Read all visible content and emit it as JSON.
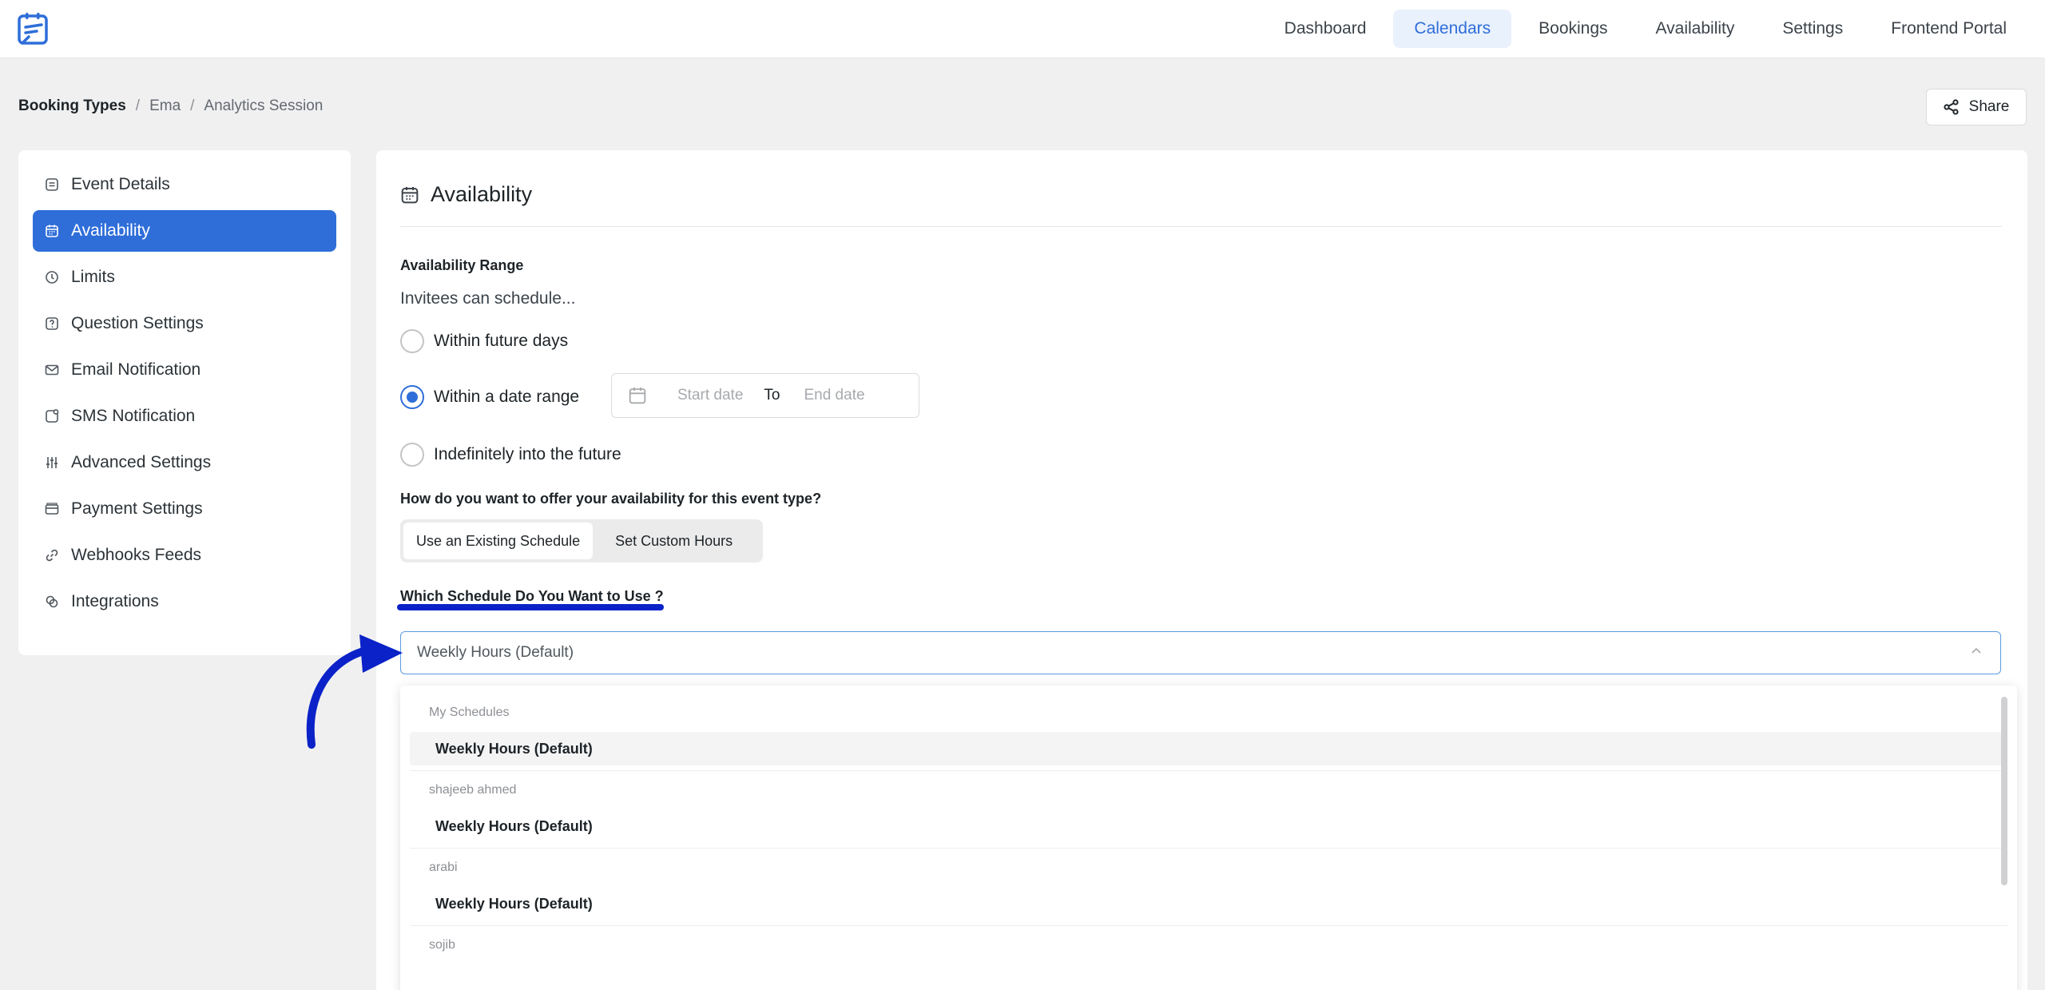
{
  "colors": {
    "accent": "#2f6ed9",
    "annotation": "#0b22c8"
  },
  "nav": {
    "items": [
      "Dashboard",
      "Calendars",
      "Bookings",
      "Availability",
      "Settings",
      "Frontend Portal"
    ],
    "active": "Calendars"
  },
  "breadcrumb": {
    "root": "Booking Types",
    "sep": "/",
    "level1": "Ema",
    "level2": "Analytics Session"
  },
  "share": {
    "label": "Share",
    "icon": "share-icon"
  },
  "sidebar": {
    "items": [
      {
        "label": "Event Details",
        "icon": "event-details-icon"
      },
      {
        "label": "Availability",
        "icon": "calendar-icon",
        "active": true
      },
      {
        "label": "Limits",
        "icon": "clock-icon"
      },
      {
        "label": "Question Settings",
        "icon": "question-icon"
      },
      {
        "label": "Email Notification",
        "icon": "mail-icon"
      },
      {
        "label": "SMS Notification",
        "icon": "sms-icon"
      },
      {
        "label": "Advanced Settings",
        "icon": "sliders-icon"
      },
      {
        "label": "Payment Settings",
        "icon": "payment-icon"
      },
      {
        "label": "Webhooks Feeds",
        "icon": "link-icon"
      },
      {
        "label": "Integrations",
        "icon": "integrations-icon"
      }
    ]
  },
  "panel": {
    "title": "Availability",
    "range_label": "Availability Range",
    "invitees_text": "Invitees can schedule...",
    "options": [
      {
        "label": "Within future days",
        "checked": false
      },
      {
        "label": "Within a date range",
        "checked": true
      },
      {
        "label": "Indefinitely into the future",
        "checked": false
      }
    ],
    "daterange": {
      "start_placeholder": "Start date",
      "to": "To",
      "end_placeholder": "End date"
    },
    "offer_question": "How do you want to offer your availability for this event type?",
    "segment": {
      "existing": "Use an Existing Schedule",
      "custom": "Set Custom Hours",
      "active": "existing"
    },
    "schedule_question": "Which Schedule Do You Want to Use ?",
    "select_value": "Weekly Hours (Default)"
  },
  "dropdown": {
    "groups": [
      {
        "name": "My Schedules",
        "options": [
          "Weekly Hours (Default)"
        ]
      },
      {
        "name": "shajeeb ahmed",
        "options": [
          "Weekly Hours (Default)"
        ]
      },
      {
        "name": "arabi",
        "options": [
          "Weekly Hours (Default)"
        ]
      },
      {
        "name": "sojib",
        "options": []
      }
    ]
  }
}
